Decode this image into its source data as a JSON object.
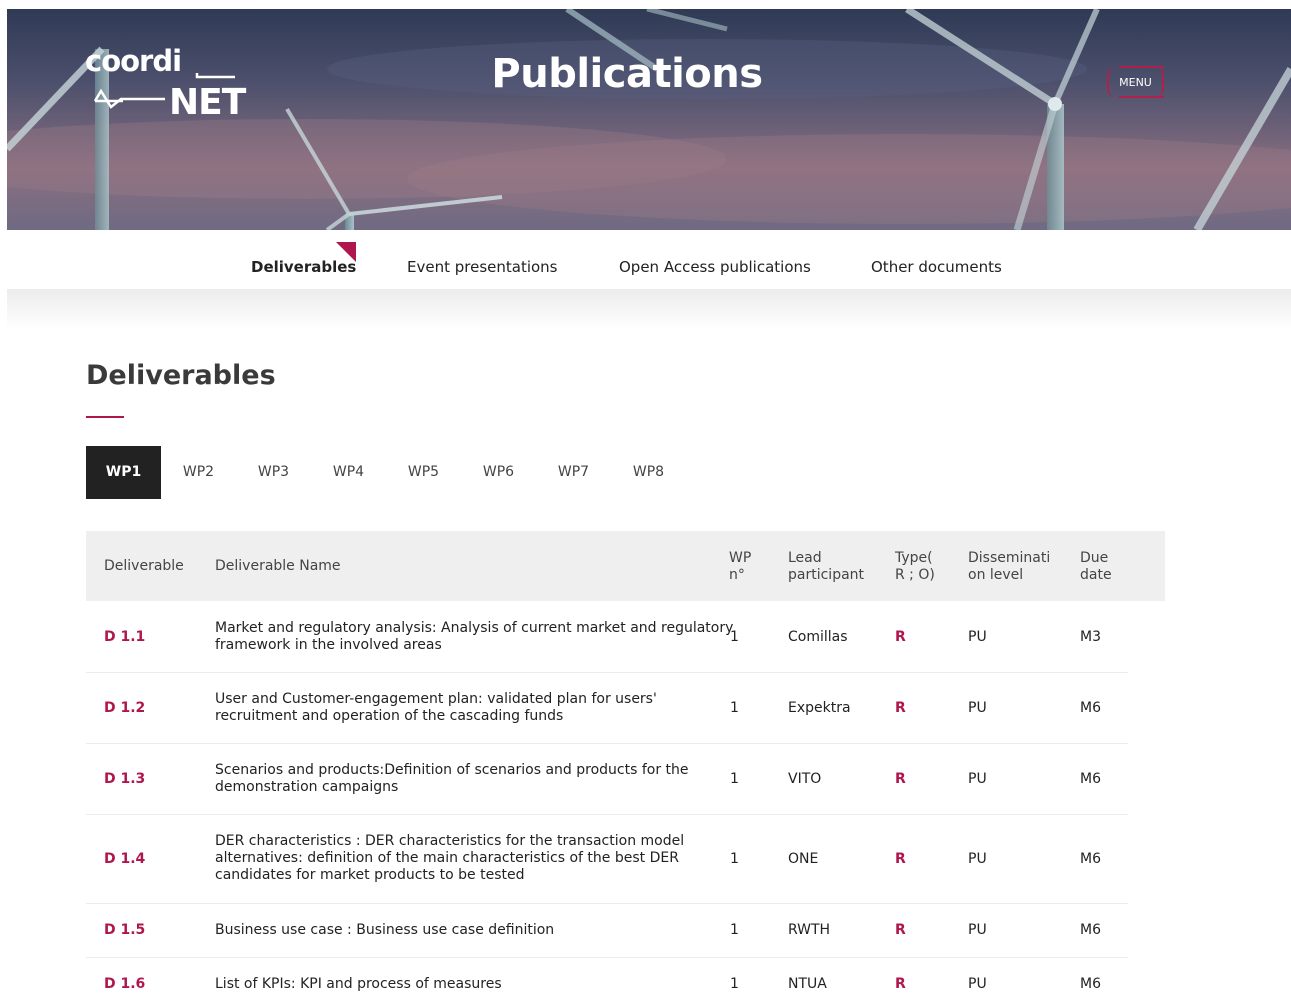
{
  "header": {
    "logo_top": "coordi",
    "logo_bottom": "NET",
    "title": "Publications",
    "menu_label": "MENU"
  },
  "subnav": {
    "tabs": [
      {
        "label": "Deliverables",
        "active": true
      },
      {
        "label": "Event presentations",
        "active": false
      },
      {
        "label": "Open Access publications",
        "active": false
      },
      {
        "label": "Other documents",
        "active": false
      }
    ]
  },
  "section": {
    "title": "Deliverables"
  },
  "wp_tabs": [
    "WP1",
    "WP2",
    "WP3",
    "WP4",
    "WP5",
    "WP6",
    "WP7",
    "WP8"
  ],
  "wp_active": "WP1",
  "table": {
    "headers": {
      "deliverable": "Deliverable",
      "name": "Deliverable Name",
      "wp_line1": "WP",
      "wp_line2": "n°",
      "lead_line1": "Lead",
      "lead_line2": "participant",
      "type_line1": "Type(",
      "type_line2": "R ; O)",
      "dissem_line1": "Disseminati",
      "dissem_line2": "on level",
      "due_line1": "Due",
      "due_line2": "date"
    },
    "rows": [
      {
        "id": "D 1.1",
        "name_lines": [
          "Market and regulatory analysis: Analysis of current market and regulatory",
          "framework in the involved areas"
        ],
        "wp": "1",
        "lead": "Comillas",
        "type": "R",
        "dissemination": "PU",
        "due": "M3"
      },
      {
        "id": "D 1.2",
        "name_lines": [
          "User and Customer-engagement plan: validated plan for users'",
          "recruitment and operation of the cascading funds"
        ],
        "wp": "1",
        "lead": "Expektra",
        "type": "R",
        "dissemination": "PU",
        "due": "M6"
      },
      {
        "id": "D 1.3",
        "name_lines": [
          "Scenarios and products:Definition of scenarios and products for the",
          "demonstration campaigns"
        ],
        "wp": "1",
        "lead": "VITO",
        "type": "R",
        "dissemination": "PU",
        "due": "M6"
      },
      {
        "id": "D 1.4",
        "name_lines": [
          "DER characteristics : DER characteristics for the transaction model",
          "alternatives: definition of the main characteristics of the best DER",
          "candidates for market products to be tested"
        ],
        "wp": "1",
        "lead": "ONE",
        "type": "R",
        "dissemination": "PU",
        "due": "M6"
      },
      {
        "id": "D 1.5",
        "name_lines": [
          "Business use case : Business use case definition"
        ],
        "wp": "1",
        "lead": "RWTH",
        "type": "R",
        "dissemination": "PU",
        "due": "M6"
      },
      {
        "id": "D 1.6",
        "name_lines": [
          "List of KPIs: KPI and process of measures"
        ],
        "wp": "1",
        "lead": "NTUA",
        "type": "R",
        "dissemination": "PU",
        "due": "M6"
      }
    ]
  }
}
